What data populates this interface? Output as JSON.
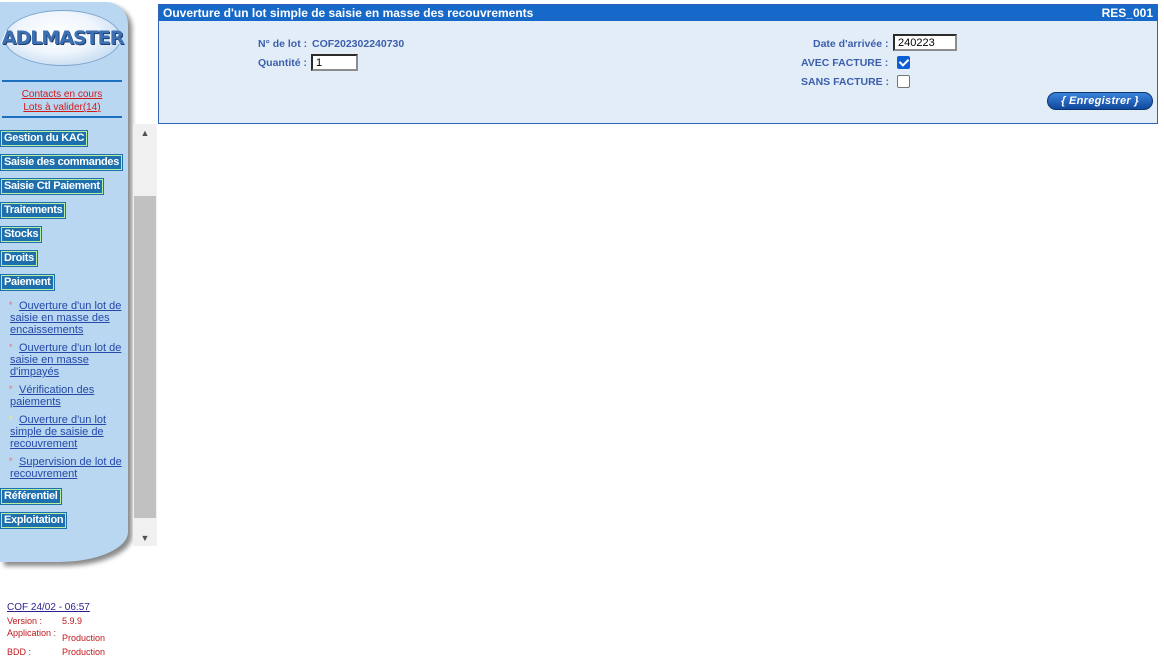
{
  "sidebar": {
    "logo_text": "ADLMASTER",
    "contacts_link": "Contacts en cours",
    "lots_link": "Lots à valider(14)",
    "menu": [
      {
        "label": "Gestion du KAC"
      },
      {
        "label": "Saisie des commandes"
      },
      {
        "label": "Saisie Ctl Paiement"
      },
      {
        "label": "Traitements"
      },
      {
        "label": "Stocks"
      },
      {
        "label": "Droits"
      },
      {
        "label": "Paiement"
      }
    ],
    "submenu": [
      {
        "label": "Ouverture d'un lot de saisie en masse des encaissements",
        "bullet": "*",
        "bullet_color": "#e07070"
      },
      {
        "label": "Ouverture d'un lot de saisie en masse d'impayés",
        "bullet": "*",
        "bullet_color": "#e07070"
      },
      {
        "label": "Vérification des paiements",
        "bullet": "*",
        "bullet_color": "#e07070"
      },
      {
        "label": "Ouverture d'un lot simple de saisie de recouvrement",
        "bullet": "*",
        "bullet_color": "#f2e96a"
      },
      {
        "label": "Supervision de lot de recouvrement",
        "bullet": "*",
        "bullet_color": "#e07070"
      }
    ],
    "menu_after": [
      {
        "label": "Référentiel"
      },
      {
        "label": "Exploitation"
      }
    ],
    "scroll_up_icon": "triangle-up-icon",
    "scroll_down_icon": "triangle-down-icon"
  },
  "footer": {
    "session": "COF 24/02 - 06:57",
    "version_label": "Version :",
    "version_value": "5.9.9",
    "application_label": "Application :",
    "application_value": "Production",
    "bdd_label": "BDD :",
    "bdd_value": "Production"
  },
  "form": {
    "title": "Ouverture d'un lot simple de saisie en masse des recouvrements",
    "code": "RES_001",
    "lot_label": "N° de lot :",
    "lot_value": "COF202302240730",
    "quantity_label": "Quantité :",
    "quantity_value": "1",
    "date_label": "Date d'arrivée :",
    "date_value": "240223",
    "avec_facture_label": "AVEC FACTURE :",
    "avec_facture_checked": true,
    "sans_facture_label": "SANS FACTURE :",
    "sans_facture_checked": false,
    "save_label": "{ Enregistrer }"
  },
  "colors": {
    "header_blue": "#1769c9",
    "panel_bg": "#e3edf8",
    "sidebar_bg": "#b9d7f1",
    "menu_btn": "#1d6fae",
    "label_blue": "#3b5fad",
    "link_red": "#d01a1a"
  }
}
